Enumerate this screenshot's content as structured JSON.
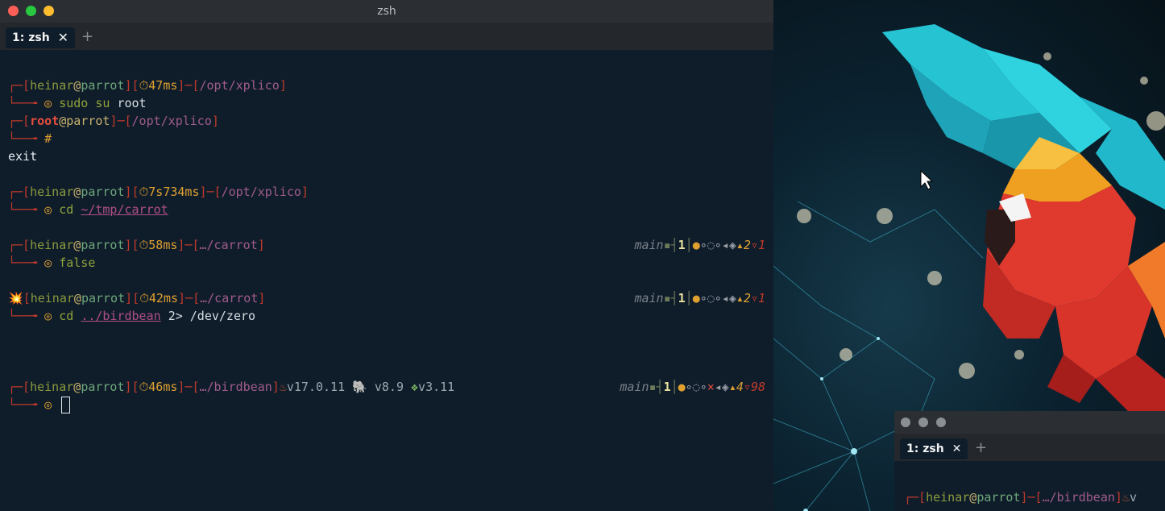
{
  "window": {
    "title": "zsh",
    "tab_label": "1: zsh",
    "tab_close": "✕",
    "new_tab": "+"
  },
  "session": [
    {
      "user": "heinar",
      "host": "parrot",
      "time": "47ms",
      "path": "/opt/xplico",
      "cmd": "sudo su",
      "arg": "root"
    },
    {
      "user": "root",
      "host": "parrot",
      "path": "/opt/xplico",
      "prompt": "#",
      "output": "exit"
    },
    {
      "user": "heinar",
      "host": "parrot",
      "time": "7s734ms",
      "path": "/opt/xplico",
      "cmd": "cd",
      "arg": "~/tmp/carrot"
    },
    {
      "user": "heinar",
      "host": "parrot",
      "time": "58ms",
      "path": "…/carrot",
      "cmd": "false",
      "git": {
        "branch": "main",
        "count": "1",
        "ahead": "2",
        "behind": "1"
      }
    },
    {
      "status_icon": "💥",
      "user": "heinar",
      "host": "parrot",
      "time": "42ms",
      "path": "…/carrot",
      "cmd": "cd",
      "arg": "../birdbean",
      "redirect": "2> /dev/zero",
      "git": {
        "branch": "main",
        "count": "1",
        "ahead": "2",
        "behind": "1"
      }
    },
    {
      "user": "heinar",
      "host": "parrot",
      "time": "46ms",
      "path": "…/birdbean",
      "java": "v17.0.11",
      "postgres": "v8.9",
      "python": "v3.11",
      "git": {
        "branch": "main",
        "count": "1",
        "ahead": "4",
        "behind": "98"
      }
    }
  ],
  "second_window": {
    "tab_label": "1: zsh",
    "tab_close": "✕",
    "new_tab": "+",
    "user": "heinar",
    "host": "parrot",
    "path": "…/birdbean",
    "trail": "v"
  },
  "icons": {
    "timer": "stopwatch-icon",
    "java": "java-cup-icon",
    "postgres": "elephant-icon",
    "python": "python-icon"
  }
}
